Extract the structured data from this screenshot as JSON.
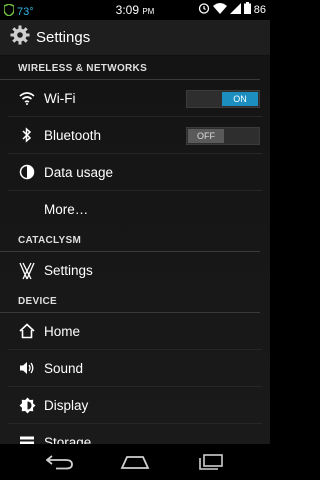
{
  "status_bar": {
    "temperature": "73°",
    "time": "3:09",
    "ampm": "PM",
    "battery": "86"
  },
  "action_bar": {
    "title": "Settings"
  },
  "sections": {
    "wireless": {
      "header": "WIRELESS & NETWORKS",
      "wifi": {
        "label": "Wi-Fi",
        "toggle": "ON"
      },
      "bluetooth": {
        "label": "Bluetooth",
        "toggle": "OFF"
      },
      "data_usage": {
        "label": "Data usage"
      },
      "more": {
        "label": "More…"
      }
    },
    "cataclysm": {
      "header": "CATACLYSM",
      "settings": {
        "label": "Settings"
      }
    },
    "device": {
      "header": "DEVICE",
      "home": {
        "label": "Home"
      },
      "sound": {
        "label": "Sound"
      },
      "display": {
        "label": "Display"
      },
      "storage": {
        "label": "Storage"
      }
    }
  },
  "colors": {
    "accent": "#33b5e5",
    "toggle_on": "#1c8fc0"
  }
}
